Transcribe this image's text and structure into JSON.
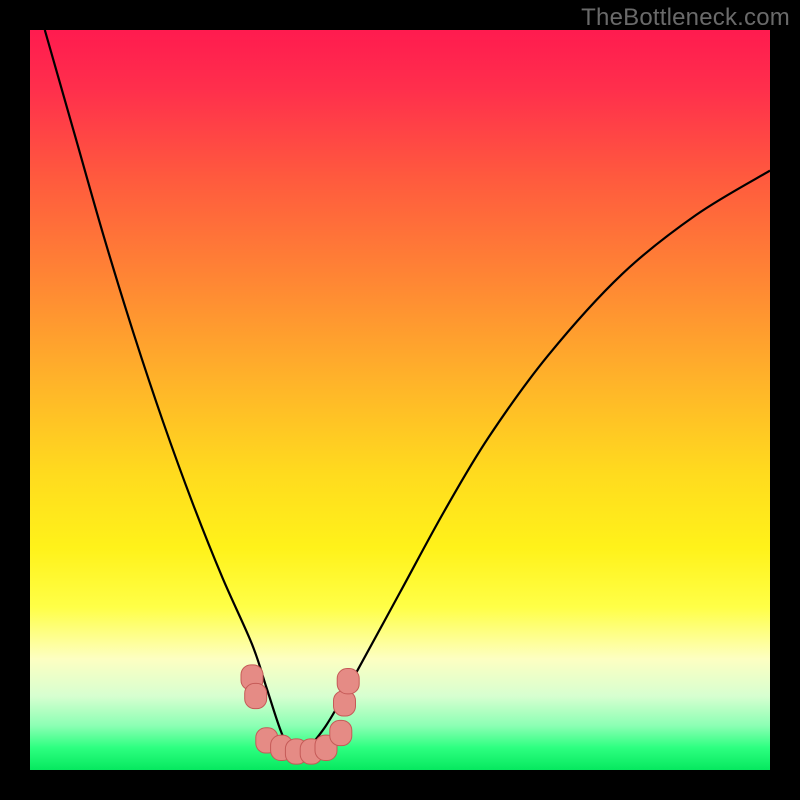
{
  "watermark": "TheBottleneck.com",
  "colors": {
    "frame": "#000000",
    "curve": "#000000",
    "marker_fill": "#e58b85",
    "marker_stroke": "#c55a57",
    "gradient_top": "#ff1b4f",
    "gradient_bottom": "#06e85f"
  },
  "chart_data": {
    "type": "line",
    "title": "",
    "xlabel": "",
    "ylabel": "",
    "xlim": [
      0,
      100
    ],
    "ylim": [
      0,
      100
    ],
    "grid": false,
    "legend": false,
    "note": "Axes are in percent of plot area; (0,0) is bottom-left. Values are estimated from pixel positions. Two smooth branches form a V bottoming near x≈36.",
    "series": [
      {
        "name": "left-branch",
        "x": [
          2,
          6,
          10,
          14,
          18,
          22,
          26,
          30,
          32,
          34,
          36
        ],
        "y": [
          100,
          86,
          72,
          59,
          47,
          36,
          26,
          17,
          11,
          5,
          1
        ]
      },
      {
        "name": "right-branch",
        "x": [
          36,
          40,
          44,
          50,
          56,
          62,
          70,
          80,
          90,
          100
        ],
        "y": [
          1,
          6,
          13,
          24,
          35,
          45,
          56,
          67,
          75,
          81
        ]
      }
    ],
    "markers": {
      "name": "bottom-cluster",
      "x": [
        30,
        30.5,
        32,
        34,
        36,
        38,
        40,
        42,
        42.5,
        43
      ],
      "y": [
        12.5,
        10,
        4,
        3,
        2.5,
        2.5,
        3,
        5,
        9,
        12
      ],
      "size": 11
    }
  }
}
